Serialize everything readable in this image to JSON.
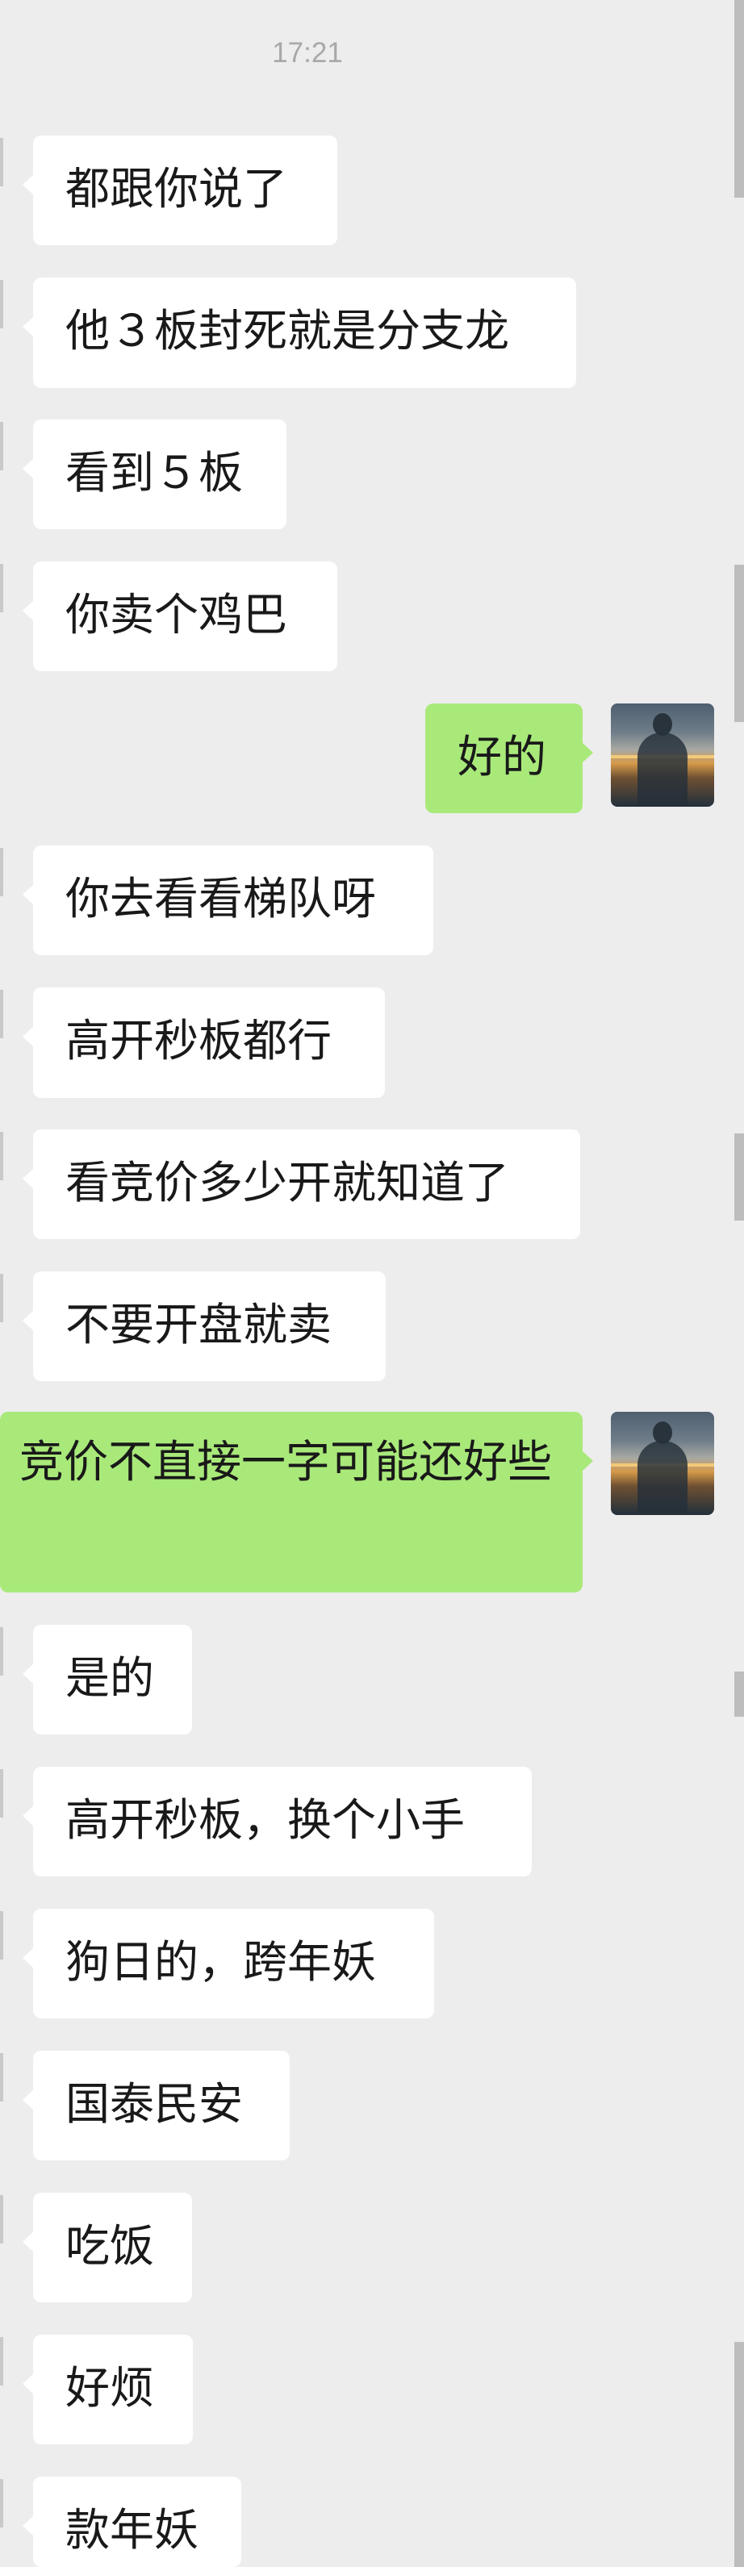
{
  "chat": {
    "timestamp": "17:21",
    "messages": [
      {
        "side": "in",
        "text": "都跟你说了"
      },
      {
        "side": "in",
        "text": "他３板封死就是分支龙"
      },
      {
        "side": "in",
        "text": "看到５板"
      },
      {
        "side": "in",
        "text": "你卖个鸡巴"
      },
      {
        "side": "out",
        "text": "好的"
      },
      {
        "side": "in",
        "text": "你去看看梯队呀"
      },
      {
        "side": "in",
        "text": "高开秒板都行"
      },
      {
        "side": "in",
        "text": "看竞价多少开就知道了"
      },
      {
        "side": "in",
        "text": "不要开盘就卖"
      },
      {
        "side": "out",
        "text": "竞价不直接一字可能还好些"
      },
      {
        "side": "in",
        "text": "是的"
      },
      {
        "side": "in",
        "text": "高开秒板，换个小手"
      },
      {
        "side": "in",
        "text": "狗日的，跨年妖"
      },
      {
        "side": "in",
        "text": "国泰民安"
      },
      {
        "side": "in",
        "text": "吃饭"
      },
      {
        "side": "in",
        "text": "好烦"
      },
      {
        "side": "in",
        "text": "款年妖"
      }
    ]
  },
  "icons": {
    "own_avatar": "user-avatar-icon",
    "bubble_tail": "bubble-tail-icon"
  },
  "colors": {
    "background": "#ededed",
    "incoming_bubble": "#ffffff",
    "outgoing_bubble": "#a9e97a",
    "text": "#191919",
    "timestamp": "#a8a8a8"
  }
}
